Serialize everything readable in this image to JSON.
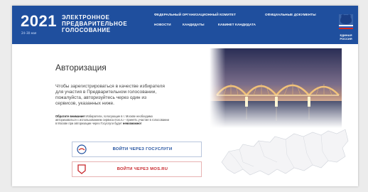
{
  "header": {
    "year": "2021",
    "dates": "24–30 мая",
    "brand_line1": "ЭЛЕКТРОННОЕ",
    "brand_line2": "ПРЕДВАРИТЕЛЬНОЕ",
    "brand_line3": "ГОЛОСОВАНИЕ",
    "nav_items": [
      "ФЕДЕРАЛЬНЫЙ ОРГАНИЗАЦИОННЫЙ КОМИТЕТ",
      "ОФИЦИАЛЬНЫЕ ДОКУМЕНТЫ",
      "НОВОСТИ",
      "КАНДИДАТЫ",
      "КАБИНЕТ КАНДИДАТА"
    ],
    "logo_line1": "ЕДИНАЯ",
    "logo_line2": "РОССИЯ"
  },
  "auth": {
    "title": "Авторизация",
    "description": "Чтобы зарегистрироваться в качестве избирателя для участия в Предварительном голосовании, пожалуйста, авторизуйтесь через один из сервисов, указанных ниже.",
    "note_lead": "Обратите внимание!",
    "note_text": " Избиратели, голосующие в г. Москве необходимо авторизоваться с использованием сервиса mos.ru – принять участие в голосовании в Москве при авторизации через Госуслуги будет ",
    "note_tail": "невозможно!",
    "gos_button": "ВОЙТИ ЧЕРЕЗ ГОСУСЛУГИ",
    "mos_button": "ВОЙТИ ЧЕРЕЗ MOS.RU"
  },
  "colors": {
    "header_bg": "#1f4f9e",
    "gos_accent": "#1f4f9e",
    "mos_accent": "#c8262b"
  },
  "icons": [
    "party-bear-logo-icon",
    "gosuslugi-icon",
    "mos-ru-icon",
    "bridge-photo",
    "russia-map"
  ]
}
